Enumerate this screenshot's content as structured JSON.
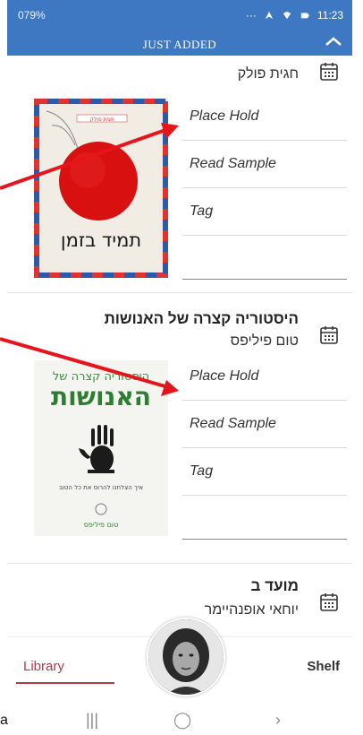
{
  "status_bar": {
    "left_text": "079%",
    "time": "11:23"
  },
  "header": {
    "title": "JUST ADDED"
  },
  "books": [
    {
      "title": "",
      "author": "חגית פולק",
      "cover_text": "תמיד בזמן",
      "cover_author": "חגית פולק",
      "actions": [
        "Place Hold",
        "Read Sample",
        "Tag"
      ]
    },
    {
      "title": "היסטוריה קצרה של האנושות",
      "author": "טום פיליפס",
      "cover_line1": "היסטוריה קצרה של",
      "cover_line2": "האנושות",
      "cover_sub": "איך הצלחנו להרוס את כל הטוב",
      "cover_author": "טום פיליפס",
      "actions": [
        "Place Hold",
        "Read Sample",
        "Tag"
      ]
    },
    {
      "title": "מועד ב",
      "author": "יוחאי אופנהיימר"
    }
  ],
  "bottom_nav": {
    "library": "Library",
    "shelf": "Shelf"
  },
  "system_nav": {
    "recent": "|||",
    "home": "◯",
    "back": "›"
  },
  "corner_letter": "a",
  "colors": {
    "header_bg": "#3e78c2",
    "accent": "#b13a4a",
    "arrow": "#e8141b"
  }
}
